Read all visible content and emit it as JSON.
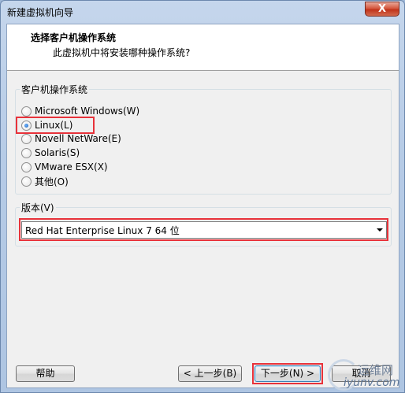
{
  "window": {
    "title": "新建虚拟机向导",
    "close_glyph": "X"
  },
  "header": {
    "title": "选择客户机操作系统",
    "subtitle": "此虚拟机中将安装哪种操作系统?"
  },
  "os_group": {
    "label": "客户机操作系统",
    "options": [
      {
        "label": "Microsoft Windows(W)",
        "checked": false
      },
      {
        "label": "Linux(L)",
        "checked": true
      },
      {
        "label": "Novell NetWare(E)",
        "checked": false
      },
      {
        "label": "Solaris(S)",
        "checked": false
      },
      {
        "label": "VMware ESX(X)",
        "checked": false
      },
      {
        "label": "其他(O)",
        "checked": false
      }
    ]
  },
  "version_group": {
    "label": "版本(V)",
    "selected": "Red Hat Enterprise Linux 7 64 位"
  },
  "footer": {
    "help_label": "帮助",
    "back_label": "< 上一步(B)",
    "next_label": "下一步(N) >",
    "cancel_label": "取消"
  },
  "watermark": {
    "cn": "运维网",
    "en": "iyunv.com"
  },
  "colors": {
    "highlight": "#e8323a",
    "accent": "#3c7fb1"
  }
}
